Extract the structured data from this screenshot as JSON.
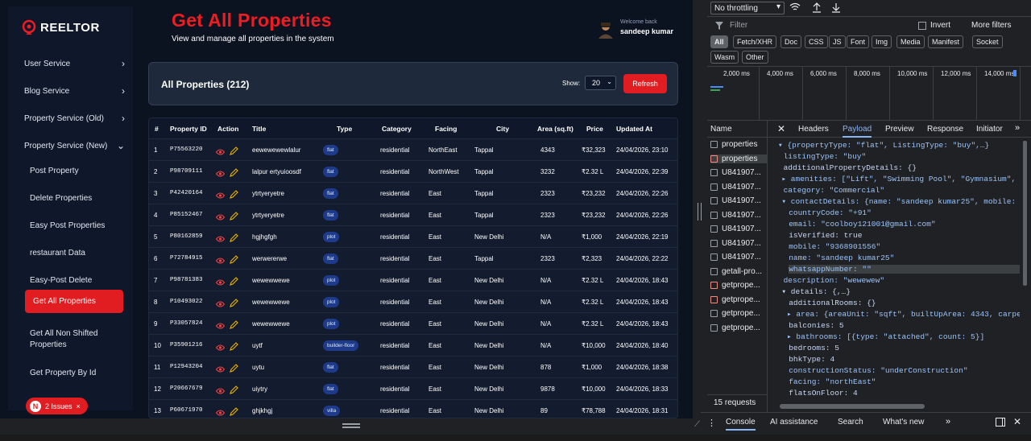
{
  "app": {
    "logo": "REELTOR",
    "title": "Get All Properties",
    "subtitle": "View and manage all properties in the system",
    "welcome": "Welcome back",
    "user": "sandeep kumar"
  },
  "sidebar": {
    "items": [
      {
        "label": "User Service",
        "chevron": "›"
      },
      {
        "label": "Blog Service",
        "chevron": "›"
      },
      {
        "label": "Property Service (Old)",
        "chevron": "›"
      },
      {
        "label": "Property Service (New)",
        "chevron": "⌄"
      }
    ],
    "sub_items": [
      "Post Property",
      "Delete Properties",
      "Easy Post Properties",
      "restaurant Data",
      "Easy-Post Delete",
      "Get All Properties",
      "Get All Non Shifted Properties",
      "Get Property By Id"
    ],
    "active": "Get All Properties",
    "issues": {
      "badge": "N",
      "label": "2 Issues",
      "close": "×"
    }
  },
  "card": {
    "title": "All Properties (212)",
    "show_label": "Show:",
    "show_value": "20",
    "refresh": "Refresh"
  },
  "table": {
    "headers": [
      "#",
      "Property ID",
      "Action",
      "Title",
      "Type",
      "Category",
      "Facing",
      "City",
      "Area (sq.ft)",
      "Price",
      "Updated At"
    ],
    "rows": [
      [
        "1",
        "P75563220",
        "eewewewewlalur",
        "flat",
        "residential",
        "NorthEast",
        "Tappal",
        "4343",
        "₹32,323",
        "24/04/2026, 23:10"
      ],
      [
        "2",
        "P98709111",
        "lalpur ertyuioosdf",
        "flat",
        "residential",
        "NorthWest",
        "Tappal",
        "3232",
        "₹2.32 L",
        "24/04/2026, 22:39"
      ],
      [
        "3",
        "P42420164",
        "ytrtyeryetre",
        "flat",
        "residential",
        "East",
        "Tappal",
        "2323",
        "₹23,232",
        "24/04/2026, 22:26"
      ],
      [
        "4",
        "P85152467",
        "ytrtyeryetre",
        "flat",
        "residential",
        "East",
        "Tappal",
        "2323",
        "₹23,232",
        "24/04/2026, 22:26"
      ],
      [
        "5",
        "P80162859",
        "hgjhgfgh",
        "plot",
        "residential",
        "East",
        "New Delhi",
        "N/A",
        "₹1,000",
        "24/04/2026, 22:19"
      ],
      [
        "6",
        "P72784915",
        "werwererwe",
        "flat",
        "residential",
        "East",
        "Tappal",
        "2323",
        "₹2,323",
        "24/04/2026, 22:22"
      ],
      [
        "7",
        "P98781383",
        "wewewwewe",
        "plot",
        "residential",
        "East",
        "New Delhi",
        "N/A",
        "₹2.32 L",
        "24/04/2026, 18:43"
      ],
      [
        "8",
        "P10493022",
        "wewewwewe",
        "plot",
        "residential",
        "East",
        "New Delhi",
        "N/A",
        "₹2.32 L",
        "24/04/2026, 18:43"
      ],
      [
        "9",
        "P33057824",
        "wewewwewe",
        "plot",
        "residential",
        "East",
        "New Delhi",
        "N/A",
        "₹2.32 L",
        "24/04/2026, 18:43"
      ],
      [
        "10",
        "P35901216",
        "uytf",
        "builder-floor",
        "residential",
        "East",
        "New Delhi",
        "N/A",
        "₹10,000",
        "24/04/2026, 18:40"
      ],
      [
        "11",
        "P12943204",
        "uytu",
        "flat",
        "residential",
        "East",
        "New Delhi",
        "878",
        "₹1,000",
        "24/04/2026, 18:38"
      ],
      [
        "12",
        "P20667679",
        "uiytry",
        "flat",
        "residential",
        "East",
        "New Delhi",
        "9878",
        "₹10,000",
        "24/04/2026, 18:33"
      ],
      [
        "13",
        "P60671970",
        "ghjkhgj",
        "villa",
        "residential",
        "East",
        "New Delhi",
        "89",
        "₹78,788",
        "24/04/2026, 18:31"
      ]
    ]
  },
  "devtools": {
    "throttle": "No throttling",
    "filter_placeholder": "Filter",
    "invert": "Invert",
    "more_filters": "More filters",
    "chips": [
      "All",
      "Fetch/XHR",
      "Doc",
      "CSS",
      "JS",
      "Font",
      "Img",
      "Media",
      "Manifest",
      "Socket",
      "Wasm",
      "Other"
    ],
    "timeline_ticks": [
      "2,000 ms",
      "4,000 ms",
      "6,000 ms",
      "8,000 ms",
      "10,000 ms",
      "12,000 ms",
      "14,000 ms"
    ],
    "name_header": "Name",
    "tabs": [
      "Headers",
      "Payload",
      "Preview",
      "Response",
      "Initiator"
    ],
    "requests": [
      "properties",
      "properties",
      "U841907...",
      "U841907...",
      "U841907...",
      "U841907...",
      "U841907...",
      "U841907...",
      "U841907...",
      "getall-pro...",
      "getprope...",
      "getprope...",
      "getprope...",
      "getprope..."
    ],
    "request_count": "15 requests",
    "payload_lines": [
      "▾ {propertyType: \"flat\", ListingType: \"buy\",…}",
      "listingType: \"buy\"",
      "additionalPropertyDetails: {}",
      "▸ amenities: [\"Lift\", \"Swimming Pool\", \"Gymnasium\", \"",
      "category: \"Commercial\"",
      "▾ contactDetails: {name: \"sandeep kumar25\", mobile: \"",
      "countryCode: \"+91\"",
      "email: \"coolboy121001@gmail.com\"",
      "isVerified: true",
      "mobile: \"9368901556\"",
      "name: \"sandeep kumar25\"",
      "whatsappNumber: \"\"",
      "description: \"wewewew\"",
      "▾ details: {,…}",
      "additionalRooms: {}",
      "▸ area: {areaUnit: \"sqft\", builtUpArea: 4343, carpe",
      "balconies: 5",
      "▸ bathrooms: [{type: \"attached\", count: 5}]",
      "bedrooms: 5",
      "bhkType: 4",
      "constructionStatus: \"underConstruction\"",
      "facing: \"northEast\"",
      "flatsOnFloor: 4"
    ],
    "bottom_tabs": [
      "Console",
      "AI assistance",
      "Search",
      "What's new"
    ]
  },
  "colors": {
    "accent": "#e11d22",
    "bg": "#0b1220",
    "panel": "#1e293b"
  }
}
